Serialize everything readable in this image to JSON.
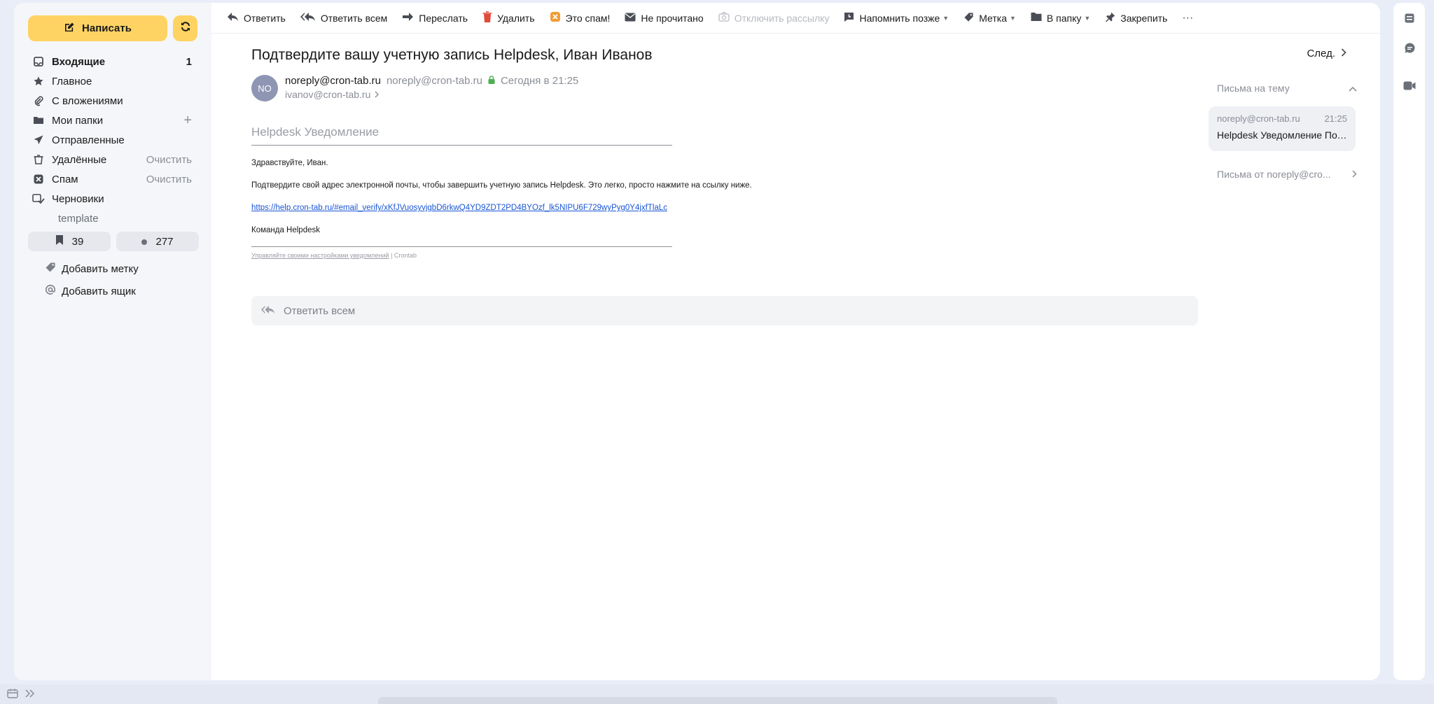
{
  "compose": {
    "label": "Написать"
  },
  "folders": [
    {
      "label": "Входящие",
      "count": "1",
      "icon": "inbox-icon",
      "bold": true
    },
    {
      "label": "Главное",
      "icon": "star-icon"
    },
    {
      "label": "С вложениями",
      "icon": "paperclip-icon"
    },
    {
      "label": "Мои папки",
      "icon": "folders-icon",
      "action": "+"
    },
    {
      "label": "Отправленные",
      "icon": "sent-icon"
    },
    {
      "label": "Удалённые",
      "icon": "trash-icon",
      "action": "Очистить"
    },
    {
      "label": "Спам",
      "icon": "spam-icon",
      "action": "Очистить"
    },
    {
      "label": "Черновики",
      "icon": "drafts-icon"
    },
    {
      "label": "template",
      "sub": true
    }
  ],
  "chips": {
    "bookmarks": "39",
    "unread": "277"
  },
  "extra": {
    "add_label": "Добавить метку",
    "add_box": "Добавить ящик"
  },
  "toolbar": {
    "reply": "Ответить",
    "reply_all": "Ответить всем",
    "forward": "Переслать",
    "delete": "Удалить",
    "spam": "Это спам!",
    "unread": "Не прочитано",
    "unsubscribe": "Отключить рассылку",
    "remind": "Напомнить позже",
    "label": "Метка",
    "to_folder": "В папку",
    "pin": "Закрепить",
    "more": "···"
  },
  "message": {
    "subject": "Подтвердите вашу учетную запись Helpdesk, Иван Иванов",
    "next": "След.",
    "avatar": "NO",
    "from_name": "noreply@cron-tab.ru",
    "from_addr": "noreply@cron-tab.ru",
    "date": "Сегодня в 21:25",
    "to": "ivanov@cron-tab.ru"
  },
  "mail": {
    "heading": "Helpdesk Уведомление",
    "greeting": "Здравствуйте, Иван.",
    "text": "Подтвердите свой адрес электронной почты, чтобы завершить учетную запись Helpdesk. Это легко, просто нажмите на ссылку ниже.",
    "link": "https://help.cron-tab.ru/#email_verify/xKfJVuosyvjgbD6rkwQ4YD9ZDT2PD4BYOzf_lk5NIPU6F729wyPyg0Y4jxfTlaLc",
    "signature": "Команда Helpdesk",
    "footer_link": "Управляйте своими настройками уведомлений",
    "footer_rest": " | Crontab"
  },
  "reply_bar": "Ответить всем",
  "thread": {
    "header": "Письма на тему",
    "item_from": "noreply@cron-tab.ru",
    "item_time": "21:25",
    "item_subject": "Helpdesk Уведомление Подт...",
    "from_link": "Письма от noreply@cro..."
  }
}
